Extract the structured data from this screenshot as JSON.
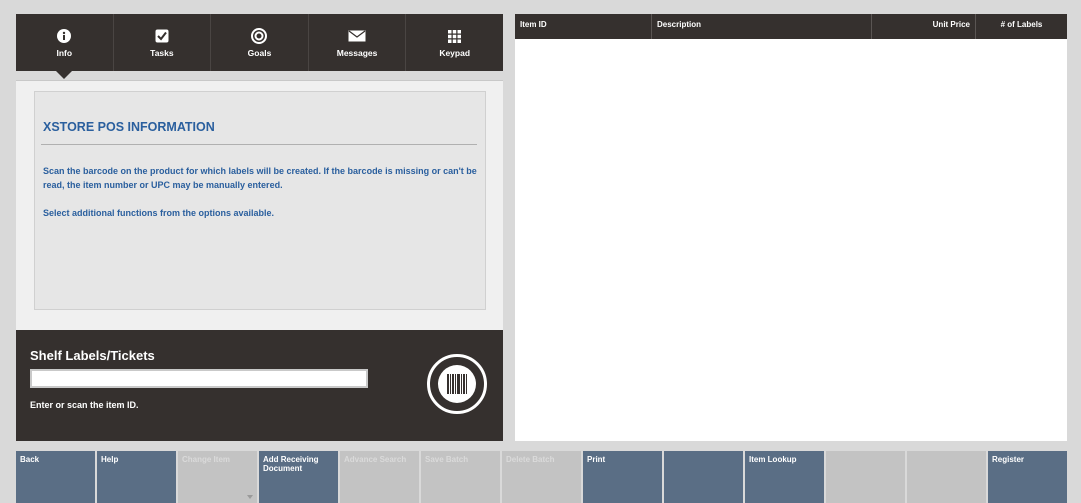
{
  "tabs": [
    {
      "label": "Info",
      "icon": "info-icon"
    },
    {
      "label": "Tasks",
      "icon": "checkbox-icon"
    },
    {
      "label": "Goals",
      "icon": "target-icon"
    },
    {
      "label": "Messages",
      "icon": "envelope-icon"
    },
    {
      "label": "Keypad",
      "icon": "keypad-icon"
    }
  ],
  "info": {
    "title": "XSTORE POS INFORMATION",
    "paragraph1": "Scan the barcode on the product for which labels will be created. If the barcode is missing or can't be read, the item number or UPC may be manually entered.",
    "paragraph2": "Select additional functions from the options available."
  },
  "scan": {
    "title": "Shelf Labels/Tickets",
    "input_value": "",
    "hint": "Enter or scan the item ID.",
    "icon": "barcode-icon"
  },
  "table": {
    "columns": [
      "Item ID",
      "Description",
      "Unit Price",
      "# of Labels"
    ],
    "rows": []
  },
  "buttons": [
    {
      "label": "Back",
      "enabled": true
    },
    {
      "label": "Help",
      "enabled": true
    },
    {
      "label": "Change Item",
      "enabled": false
    },
    {
      "label": "Add Receiving Document",
      "enabled": true
    },
    {
      "label": "Advance Search",
      "enabled": false
    },
    {
      "label": "Save Batch",
      "enabled": false
    },
    {
      "label": "Delete Batch",
      "enabled": false
    },
    {
      "label": "Print",
      "enabled": true
    },
    {
      "label": "",
      "enabled": true
    },
    {
      "label": "Item Lookup",
      "enabled": true
    },
    {
      "label": "",
      "enabled": false
    },
    {
      "label": "",
      "enabled": false
    },
    {
      "label": "Register",
      "enabled": true
    }
  ],
  "colors": {
    "dark": "#35302e",
    "accent_blue": "#2a5f9e",
    "button_active": "#5a6e85",
    "button_disabled": "#c3c3c3"
  }
}
